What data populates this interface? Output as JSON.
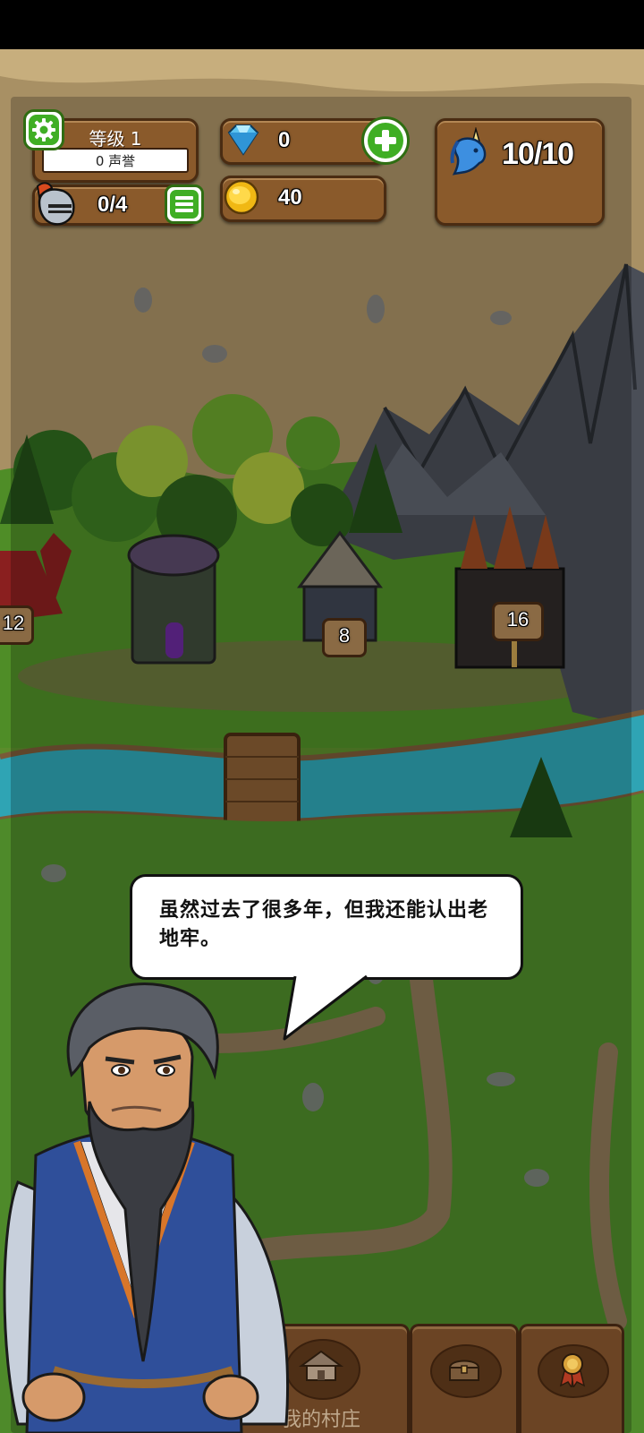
{
  "hud": {
    "level_label": "等级 1",
    "reputation": "0 声誉",
    "knights": "0/4",
    "gems": "0",
    "gold": "40",
    "unicorn_energy": "10/10"
  },
  "map": {
    "dungeons": [
      {
        "level": "12"
      },
      {
        "level": "8"
      },
      {
        "level": "16"
      }
    ]
  },
  "dialog": {
    "text": "虽然过去了很多年，但我还能认出老地牢。"
  },
  "bottom_nav": {
    "village_label": "我的村庄"
  },
  "icons": {
    "settings": "gear-icon",
    "gem": "diamond-icon",
    "add_gems": "plus-icon",
    "gold": "gold-coin-icon",
    "knight": "knight-helmet-icon",
    "list": "list-icon",
    "energy": "unicorn-icon",
    "chest": "treasure-chest-icon",
    "achievements": "medal-icon",
    "village": "house-icon"
  },
  "colors": {
    "panel": "#8a5a2b",
    "accent_green": "#3fae24",
    "river": "#2fa4b4",
    "grass": "#4e8a2a"
  }
}
